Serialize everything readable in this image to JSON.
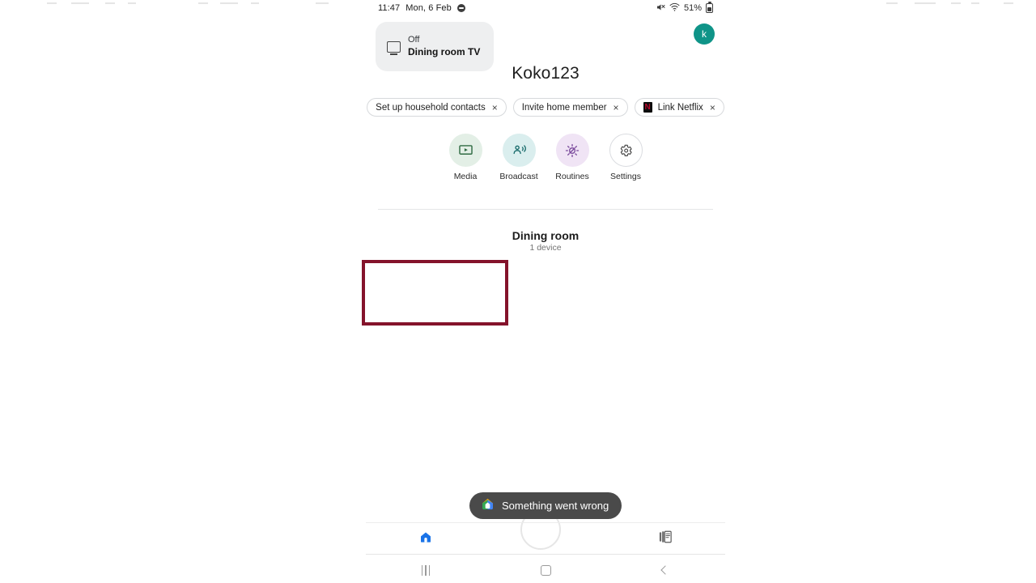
{
  "statusbar": {
    "time": "11:47",
    "date": "Mon, 6 Feb",
    "dnd_icon": "do-not-disturb-icon",
    "mute_icon": "volume-muted-icon",
    "wifi_icon": "wifi-icon",
    "battery_percent": "51%",
    "battery_icon": "battery-icon"
  },
  "appbar": {
    "add_label": "+",
    "add_icon": "plus-icon",
    "avatar_initial": "k"
  },
  "home": {
    "title": "Koko123"
  },
  "chips": [
    {
      "label": "Set up household contacts",
      "close": "×",
      "icon": ""
    },
    {
      "label": "Invite home member",
      "close": "×",
      "icon": ""
    },
    {
      "label": "Link Netflix",
      "close": "×",
      "icon": "netflix-icon",
      "icon_letter": "N"
    }
  ],
  "actions": [
    {
      "label": "Media",
      "icon": "media-icon",
      "bg": "#e3efe6",
      "fg": "#2f6b42"
    },
    {
      "label": "Broadcast",
      "icon": "broadcast-icon",
      "bg": "#daeeee",
      "fg": "#186b6b"
    },
    {
      "label": "Routines",
      "icon": "routines-icon",
      "bg": "#f0e4f5",
      "fg": "#7a4a9c"
    },
    {
      "label": "Settings",
      "icon": "settings-gear-icon",
      "bg": "#ffffff",
      "fg": "#444444"
    }
  ],
  "room": {
    "name": "Dining room",
    "device_count": "1 device"
  },
  "device": {
    "state": "Off",
    "name": "Dining room TV",
    "icon": "tv-icon"
  },
  "toast": {
    "message": "Something went wrong",
    "icon": "google-home-icon"
  },
  "bottom_nav": [
    {
      "label": "Home",
      "icon": "home-icon",
      "active": true
    },
    {
      "label": "Activity",
      "icon": "feed-icon",
      "active": false
    }
  ],
  "assistant": {
    "label": "Assistant",
    "icon": "assistant-circle-icon"
  },
  "system_nav": [
    {
      "label": "Recents",
      "icon": "recents-icon"
    },
    {
      "label": "Home",
      "icon": "home-square-icon"
    },
    {
      "label": "Back",
      "icon": "back-chevron-icon"
    }
  ],
  "annotation": {
    "color": "#84132b"
  }
}
